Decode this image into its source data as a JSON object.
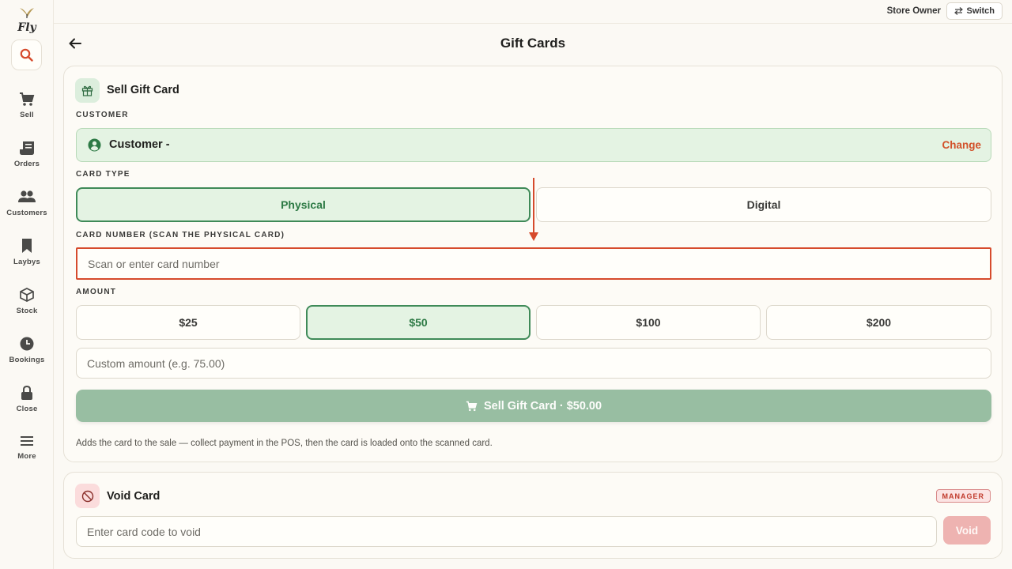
{
  "app": {
    "logo_text": "Fly"
  },
  "topbar": {
    "role": "Store Owner",
    "switch_label": "Switch"
  },
  "header": {
    "title": "Gift Cards"
  },
  "sidebar": {
    "items": [
      {
        "label": "Sell",
        "icon": "cart-icon"
      },
      {
        "label": "Orders",
        "icon": "orders-icon"
      },
      {
        "label": "Customers",
        "icon": "customers-icon"
      },
      {
        "label": "Laybys",
        "icon": "bookmark-icon"
      },
      {
        "label": "Stock",
        "icon": "box-icon"
      },
      {
        "label": "Bookings",
        "icon": "clock-icon"
      },
      {
        "label": "Close",
        "icon": "lock-icon"
      },
      {
        "label": "More",
        "icon": "menu-icon"
      }
    ]
  },
  "sell_card": {
    "title": "Sell Gift Card",
    "customer_label": "CUSTOMER",
    "customer_name": "Customer -",
    "change_label": "Change",
    "card_type_label": "CARD TYPE",
    "card_types": [
      {
        "label": "Physical",
        "selected": true
      },
      {
        "label": "Digital",
        "selected": false
      }
    ],
    "card_number_label": "CARD NUMBER (SCAN THE PHYSICAL CARD)",
    "card_number_placeholder": "Scan or enter card number",
    "amount_label": "AMOUNT",
    "amounts": [
      {
        "label": "$25",
        "selected": false
      },
      {
        "label": "$50",
        "selected": true
      },
      {
        "label": "$100",
        "selected": false
      },
      {
        "label": "$200",
        "selected": false
      }
    ],
    "custom_amount_placeholder": "Custom amount (e.g. 75.00)",
    "sell_button_label": "Sell Gift Card · $50.00",
    "help_text": "Adds the card to the sale — collect payment in the POS, then the card is loaded onto the scanned card."
  },
  "void_card": {
    "title": "Void Card",
    "badge": "MANAGER",
    "input_placeholder": "Enter card code to void",
    "void_button_label": "Void"
  },
  "colors": {
    "accent_green": "#3f8a58",
    "accent_red": "#d64a2c",
    "sell_button": "#98bea2",
    "void_button": "#eeb3b1"
  }
}
